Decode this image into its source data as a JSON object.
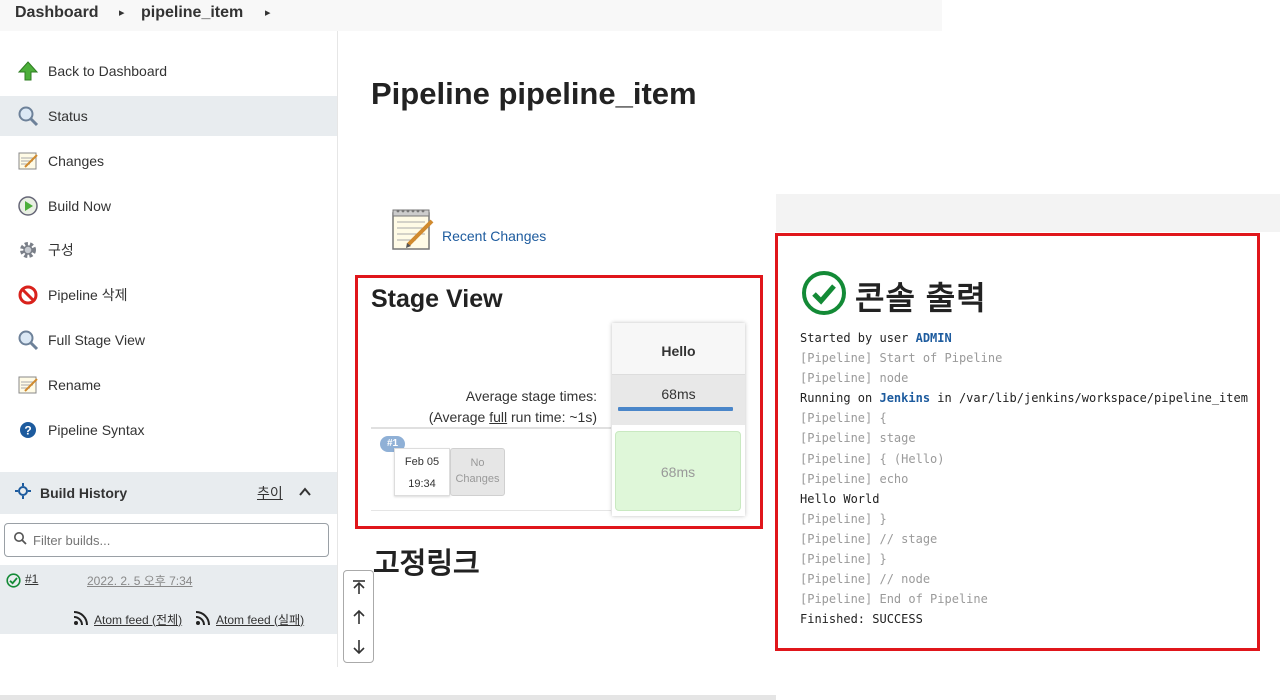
{
  "breadcrumb": {
    "home": "Dashboard",
    "job": "pipeline_item"
  },
  "sidebar": {
    "items": [
      {
        "label": "Back to Dashboard",
        "icon": "up-arrow-icon"
      },
      {
        "label": "Status",
        "icon": "search-icon"
      },
      {
        "label": "Changes",
        "icon": "notepad-icon"
      },
      {
        "label": "Build Now",
        "icon": "clock-play-icon"
      },
      {
        "label": "구성",
        "icon": "gear-icon"
      },
      {
        "label": "Pipeline 삭제",
        "icon": "no-entry-icon"
      },
      {
        "label": "Full Stage View",
        "icon": "search-icon"
      },
      {
        "label": "Rename",
        "icon": "notepad-icon"
      },
      {
        "label": "Pipeline Syntax",
        "icon": "help-icon"
      }
    ],
    "active_index": 1
  },
  "build_history": {
    "title": "Build History",
    "trend": "추이",
    "filter_placeholder": "Filter builds...",
    "builds": [
      {
        "number": "#1",
        "date": "2022. 2. 5 오후 7:34"
      }
    ],
    "feed_all": "Atom feed (전체)",
    "feed_failed": "Atom feed (실패)"
  },
  "main": {
    "title": "Pipeline pipeline_item",
    "recent_changes": "Recent Changes",
    "stage_view_title": "Stage View",
    "avg_stage_times": "Average stage times:",
    "avg_full_prefix": "(Average ",
    "avg_full_link": "full",
    "avg_full_suffix": " run time: ~1s)",
    "run_badge": "#1",
    "run_date": "Feb 05",
    "run_time": "19:34",
    "no_changes_1": "No",
    "no_changes_2": "Changes",
    "stage_name": "Hello",
    "stage_avg": "68ms",
    "stage_cell": "68ms",
    "stage_avg_fill_fraction": 1.0,
    "permalinks_title": "고정링크"
  },
  "console": {
    "title": "콘솔 출력",
    "lines": [
      {
        "parts": [
          {
            "t": "Started by user ",
            "c": "plain"
          },
          {
            "t": "ADMIN",
            "c": "link"
          }
        ]
      },
      {
        "parts": [
          {
            "t": "[Pipeline] Start of Pipeline",
            "c": "pl"
          }
        ]
      },
      {
        "parts": [
          {
            "t": "[Pipeline] node",
            "c": "pl"
          }
        ]
      },
      {
        "parts": [
          {
            "t": "Running on ",
            "c": "plain"
          },
          {
            "t": "Jenkins",
            "c": "link"
          },
          {
            "t": " in /var/lib/jenkins/workspace/pipeline_item",
            "c": "plain"
          }
        ]
      },
      {
        "parts": [
          {
            "t": "[Pipeline] {",
            "c": "pl"
          }
        ]
      },
      {
        "parts": [
          {
            "t": "[Pipeline] stage",
            "c": "pl"
          }
        ]
      },
      {
        "parts": [
          {
            "t": "[Pipeline] { (Hello)",
            "c": "pl"
          }
        ]
      },
      {
        "parts": [
          {
            "t": "[Pipeline] echo",
            "c": "pl"
          }
        ]
      },
      {
        "parts": [
          {
            "t": "Hello World",
            "c": "plain"
          }
        ]
      },
      {
        "parts": [
          {
            "t": "[Pipeline] }",
            "c": "pl"
          }
        ]
      },
      {
        "parts": [
          {
            "t": "[Pipeline] // stage",
            "c": "pl"
          }
        ]
      },
      {
        "parts": [
          {
            "t": "[Pipeline] }",
            "c": "pl"
          }
        ]
      },
      {
        "parts": [
          {
            "t": "[Pipeline] // node",
            "c": "pl"
          }
        ]
      },
      {
        "parts": [
          {
            "t": "[Pipeline] End of Pipeline",
            "c": "pl"
          }
        ]
      },
      {
        "parts": [
          {
            "t": "Finished: SUCCESS",
            "c": "plain"
          }
        ]
      }
    ]
  },
  "colors": {
    "highlight_border": "#e0161b",
    "link_blue": "#1d5b9e",
    "success_green": "#138a36",
    "stage_success_bg": "#dff7d9",
    "sidebar_active_bg": "#e8ecef"
  }
}
